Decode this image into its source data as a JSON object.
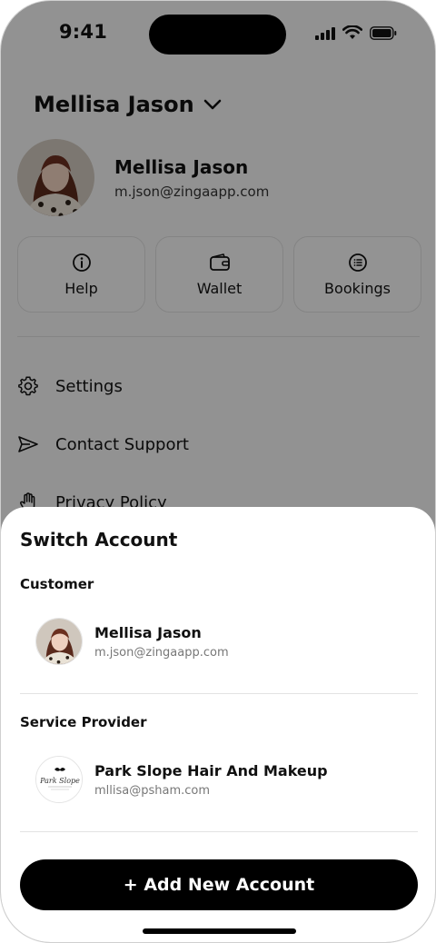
{
  "status_bar": {
    "time": "9:41",
    "icons": [
      "signal-icon",
      "wifi-icon",
      "battery-icon"
    ]
  },
  "header": {
    "account_switcher_label": "Mellisa Jason",
    "profile": {
      "name": "Mellisa Jason",
      "email": "m.json@zingaapp.com"
    }
  },
  "quick_actions": [
    {
      "label": "Help",
      "icon": "info-icon"
    },
    {
      "label": "Wallet",
      "icon": "wallet-icon"
    },
    {
      "label": "Bookings",
      "icon": "list-icon"
    }
  ],
  "menu": [
    {
      "label": "Settings",
      "icon": "gear-icon"
    },
    {
      "label": "Contact Support",
      "icon": "send-icon"
    },
    {
      "label": "Privacy Policy",
      "icon": "hand-icon"
    }
  ],
  "sheet": {
    "title": "Switch Account",
    "customer_section": {
      "label": "Customer",
      "account": {
        "name": "Mellisa Jason",
        "email": "m.json@zingaapp.com"
      }
    },
    "provider_section": {
      "label": "Service Provider",
      "account": {
        "name": "Park Slope Hair And Makeup",
        "email": "mllisa@psham.com",
        "logo_text": "Park Slope"
      }
    },
    "add_button_label": "+ Add New Account"
  },
  "colors": {
    "overlay": "rgba(0,0,0,0.4)",
    "primary_button": "#000000",
    "sheet_bg": "#ffffff"
  }
}
